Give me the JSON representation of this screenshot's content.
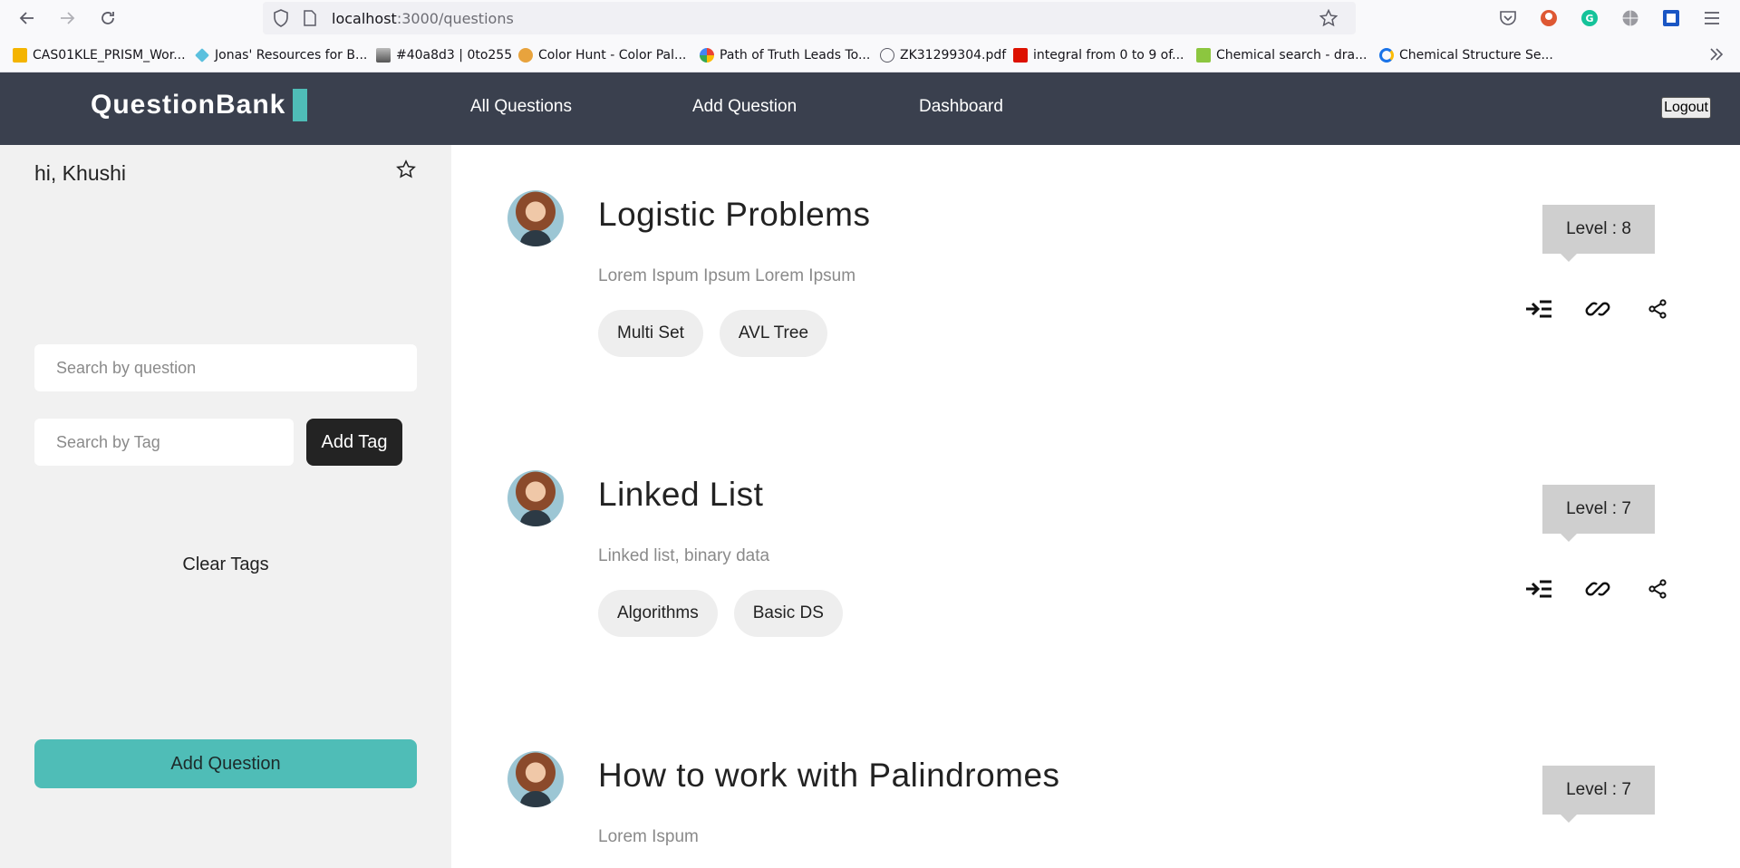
{
  "browser": {
    "url_host": "localhost",
    "url_path": ":3000/questions"
  },
  "bookmarks": [
    {
      "label": "CAS01KLE_PRISM_Wor...",
      "color": "#f4b400"
    },
    {
      "label": "Jonas' Resources for B...",
      "color": "#5bc0de"
    },
    {
      "label": "#40a8d3 | 0to255",
      "color": "#888888"
    },
    {
      "label": "Color Hunt - Color Pal...",
      "color": "#e8a33d"
    },
    {
      "label": "Path of Truth Leads To...",
      "color": "#4285f4"
    },
    {
      "label": "ZK31299304.pdf",
      "color": "#5b5b66"
    },
    {
      "label": "integral from 0 to 9 of...",
      "color": "#dd1100"
    },
    {
      "label": "Chemical search - dra...",
      "color": "#8cc63f"
    },
    {
      "label": "Chemical Structure Se...",
      "color": "#1a73e8"
    }
  ],
  "header": {
    "logo": "QuestionBank",
    "nav": [
      "All Questions",
      "Add Question",
      "Dashboard"
    ],
    "logout": "Logout",
    "accent": "#4fbdb7",
    "bg": "#3a404e"
  },
  "sidebar": {
    "greeting": "hi, Khushi",
    "search_question_placeholder": "Search by question",
    "search_tag_placeholder": "Search by Tag",
    "add_tag": "Add Tag",
    "clear_tags": "Clear Tags",
    "add_question": "Add Question"
  },
  "questions": [
    {
      "title": "Logistic Problems",
      "description": "Lorem Ispum Ipsum Lorem Ipsum",
      "tags": [
        "Multi Set",
        "AVL Tree"
      ],
      "level": "Level : 8"
    },
    {
      "title": "Linked List",
      "description": "Linked list, binary data",
      "tags": [
        "Algorithms",
        "Basic DS"
      ],
      "level": "Level : 7"
    },
    {
      "title": "How to work with Palindromes",
      "description": "Lorem Ispum",
      "tags": [],
      "level": "Level : 7"
    }
  ]
}
